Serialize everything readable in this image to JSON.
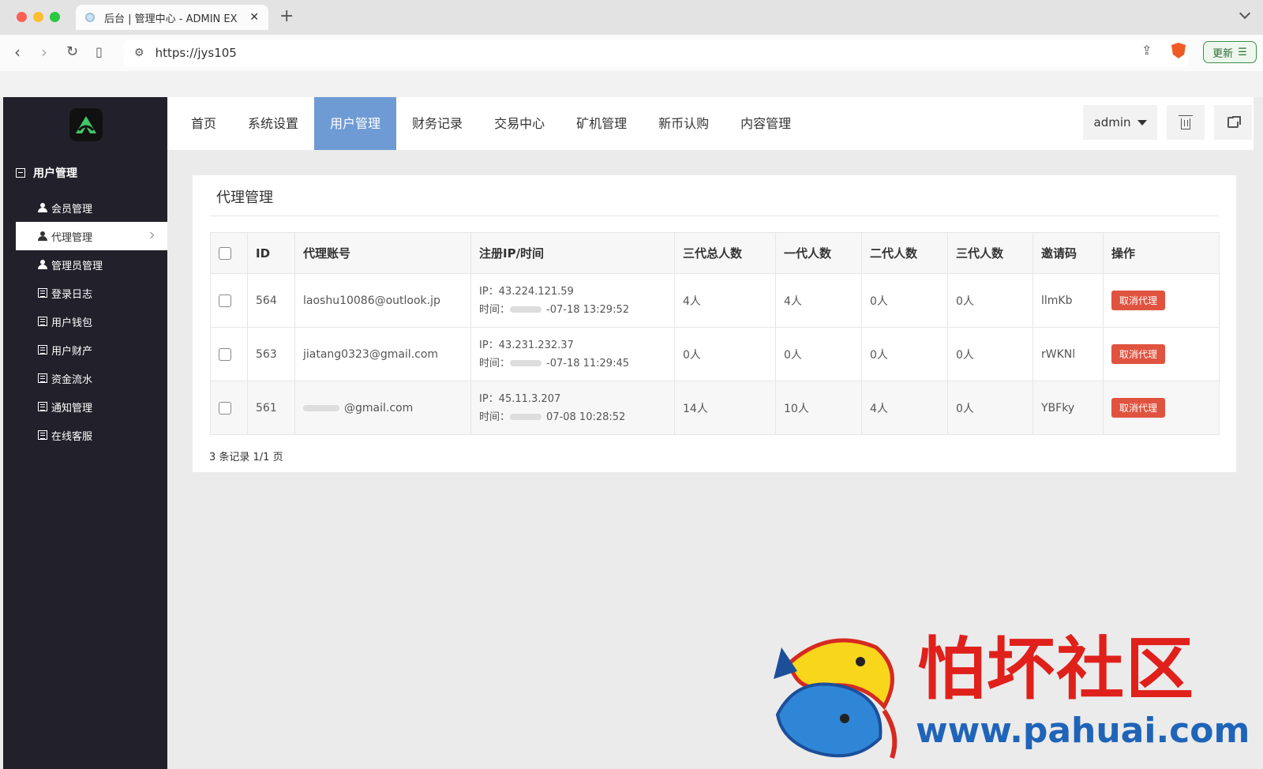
{
  "browser": {
    "tab_title": "后台 | 管理中心 - ADMIN EX",
    "url": "https://jys105",
    "update_label": "更新"
  },
  "sidebar": {
    "section_title": "用户管理",
    "items": [
      {
        "label": "会员管理",
        "icon": "user-icon"
      },
      {
        "label": "代理管理",
        "icon": "user-icon",
        "active": true
      },
      {
        "label": "管理员管理",
        "icon": "user-icon"
      },
      {
        "label": "登录日志",
        "icon": "list-icon"
      },
      {
        "label": "用户钱包",
        "icon": "list-icon"
      },
      {
        "label": "用户财产",
        "icon": "list-icon"
      },
      {
        "label": "资金流水",
        "icon": "list-icon"
      },
      {
        "label": "通知管理",
        "icon": "list-icon"
      },
      {
        "label": "在线客服",
        "icon": "list-icon"
      }
    ]
  },
  "topnav": {
    "items": [
      "首页",
      "系统设置",
      "用户管理",
      "财务记录",
      "交易中心",
      "矿机管理",
      "新币认购",
      "内容管理"
    ],
    "active_index": 2,
    "user": "admin",
    "accent": "#6f9bd4"
  },
  "panel": {
    "title": "代理管理",
    "columns": [
      "ID",
      "代理账号",
      "注册IP/时间",
      "三代总人数",
      "一代人数",
      "二代人数",
      "三代人数",
      "邀请码",
      "操作"
    ],
    "rows": [
      {
        "id": "564",
        "account": "laoshu10086@outlook.jp",
        "ip": "IP：43.224.121.59",
        "time": "时间：",
        "time_value": "-07-18 13:29:52",
        "total": "4人",
        "gen1": "4人",
        "gen2": "0人",
        "gen3": "0人",
        "code": "llmKb",
        "action": "取消代理"
      },
      {
        "id": "563",
        "account": "jiatang0323@gmail.com",
        "ip": "IP：43.231.232.37",
        "time": "时间：",
        "time_value": "-07-18 11:29:45",
        "total": "0人",
        "gen1": "0人",
        "gen2": "0人",
        "gen3": "0人",
        "code": "rWKNl",
        "action": "取消代理"
      },
      {
        "id": "561",
        "account": "@gmail.com",
        "ip": "IP：45.11.3.207",
        "time": "时间：",
        "time_value": "07-08 10:28:52",
        "total": "14人",
        "gen1": "10人",
        "gen2": "4人",
        "gen3": "0人",
        "code": "YBFky",
        "action": "取消代理"
      }
    ],
    "pager": "3 条记录 1/1 页",
    "danger_color": "#e0533f"
  },
  "watermark": {
    "title": "怕坏社区",
    "url": "www.pahuai.com"
  }
}
